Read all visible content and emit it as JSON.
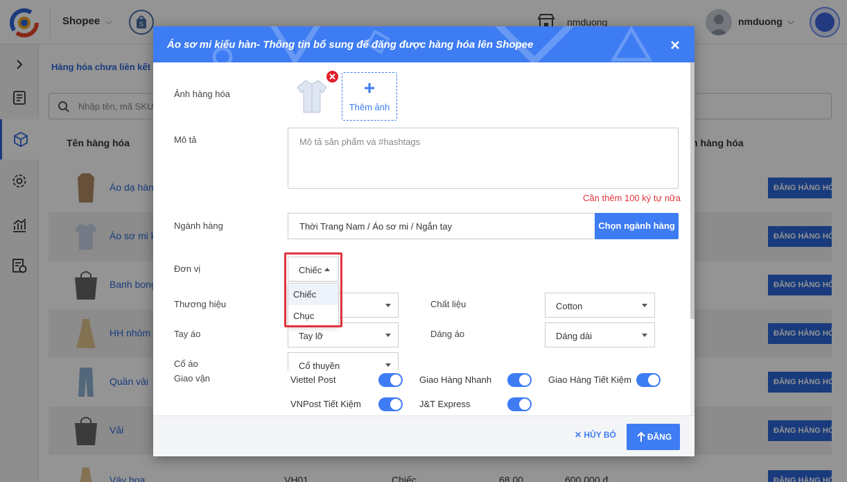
{
  "header": {
    "channel": "Shopee",
    "store_name": "nmduong",
    "user_name": "nmduong"
  },
  "sidebar": {
    "icons": [
      "chevron-right-icon",
      "document-icon",
      "box-icon",
      "gear-icon",
      "chart-icon",
      "report-icon"
    ]
  },
  "main": {
    "tab_label": "Hàng hóa chưa liên kết",
    "search_placeholder": "Nhập tên, mã SKU",
    "col_name": "Tên hàng hóa",
    "col_right": "n hàng hóa",
    "row_button_label": "ĐĂNG HÀNG HÓA",
    "rows": [
      {
        "name": "Áo dạ hàn"
      },
      {
        "name": "Áo sơ mi k"
      },
      {
        "name": "Banh bong"
      },
      {
        "name": "HH nhóm"
      },
      {
        "name": "Quần vải"
      },
      {
        "name": "Vải"
      },
      {
        "name": "Váy hoa",
        "sku": "VH01",
        "unit": "Chiếc",
        "qty": "68.00",
        "price": "600.000 đ"
      }
    ]
  },
  "modal": {
    "title": "Áo sơ mi kiểu hàn- Thông tin bổ sung để đăng được hàng hóa lên Shopee",
    "image_label": "Ảnh hàng hóa",
    "add_image_label": "Thêm ảnh",
    "desc_label": "Mô tả",
    "desc_placeholder": "Mô tả sản phẩm và #hashtags",
    "desc_warning": "Cần thêm 100 ký tự nữa",
    "category_label": "Ngành hàng",
    "category_value": "Thời Trang Nam / Áo sơ mi / Ngắn tay",
    "category_button": "Chọn ngành hàng",
    "unit_label": "Đơn vị",
    "unit_value": "Chiếc",
    "unit_options": [
      "Chiếc",
      "Chục"
    ],
    "brand_label": "Thương hiệu",
    "material_label": "Chất liệu",
    "material_value": "Cotton",
    "sleeve_label": "Tay áo",
    "sleeve_value": "Tay lỡ",
    "shape_label": "Dáng áo",
    "shape_value": "Dáng dài",
    "collar_label": "Cổ áo",
    "collar_value": "Cổ thuyền",
    "shipping_label": "Giao vận",
    "shipping": [
      {
        "name": "Viettel Post",
        "on": true
      },
      {
        "name": "Giao Hàng Nhanh",
        "on": true
      },
      {
        "name": "Giao Hàng Tiết Kiệm",
        "on": true
      },
      {
        "name": "VNPost Tiết Kiệm",
        "on": true
      },
      {
        "name": "J&T Express",
        "on": true
      }
    ],
    "cancel_label": "HỦY BỎ",
    "submit_label": "ĐĂNG"
  },
  "colors": {
    "primary": "#3d7cf2",
    "warning": "#e0343d"
  }
}
